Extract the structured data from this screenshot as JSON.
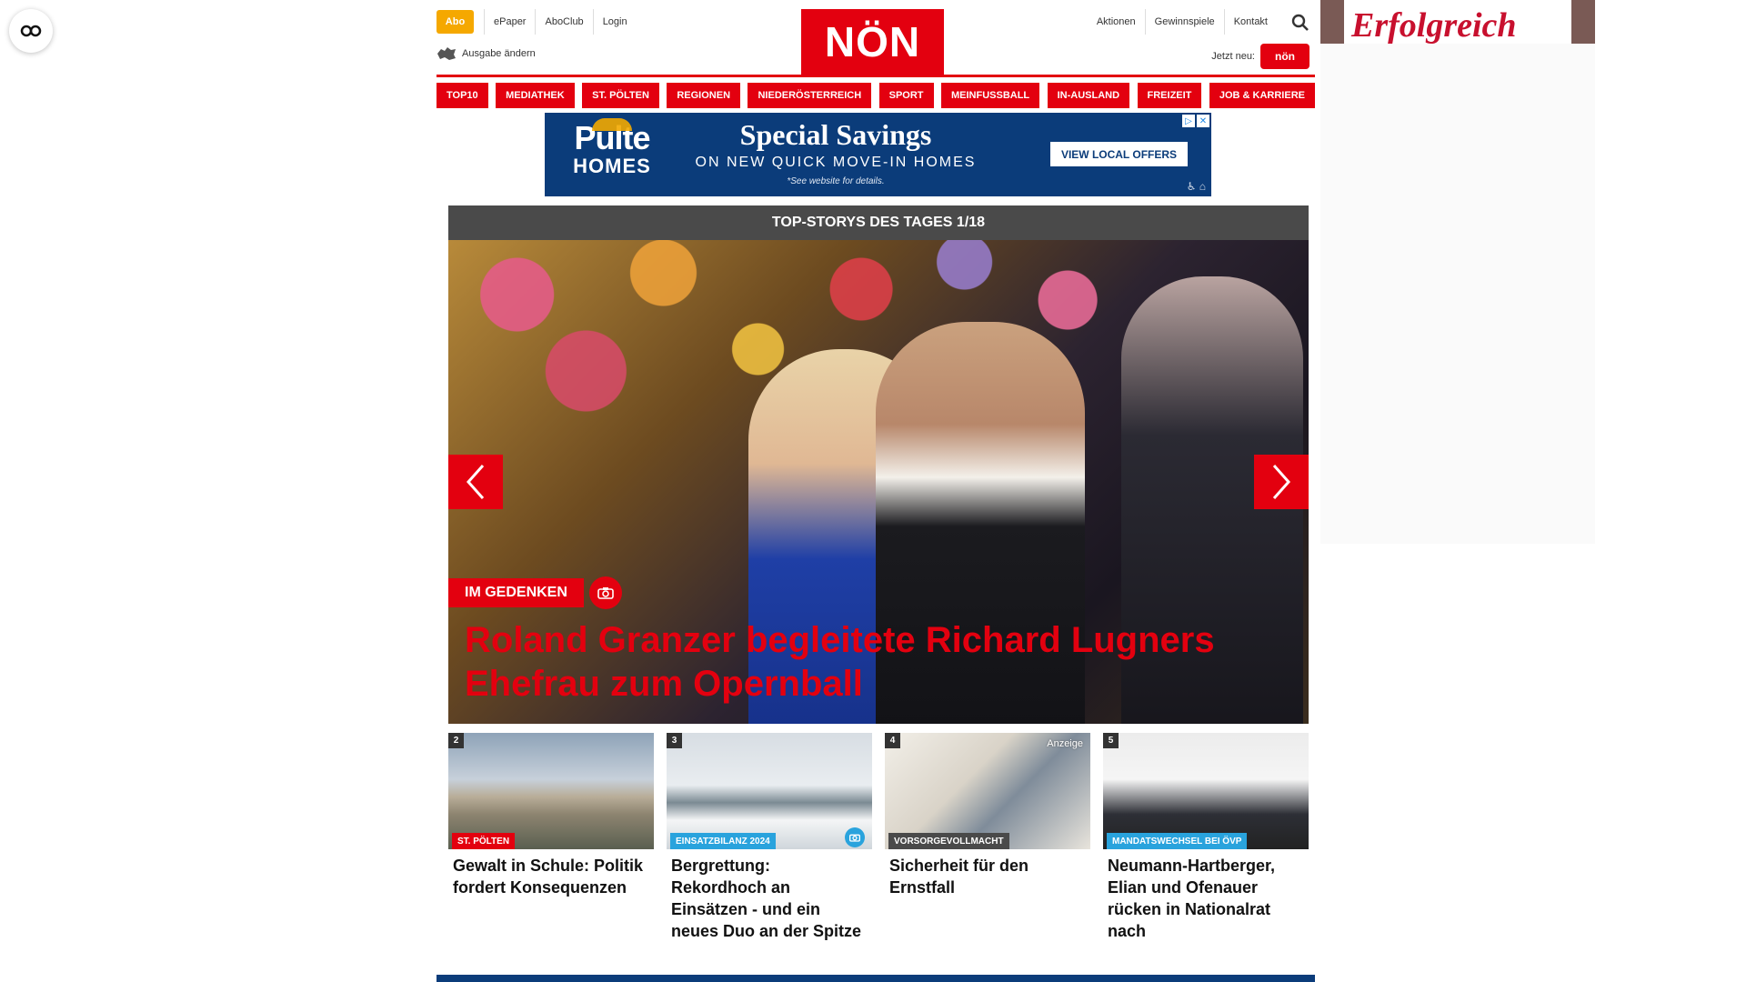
{
  "header": {
    "abo_label": "Abo",
    "left_links": [
      "ePaper",
      "AboClub",
      "Login"
    ],
    "ausgabe_label": "Ausgabe ändern",
    "logo_text": "NÖN",
    "right_links": [
      "Aktionen",
      "Gewinnspiele",
      "Kontakt"
    ],
    "jetzt_neu_label": "Jetzt neu:",
    "jetzt_neu_badge": "nön"
  },
  "side_ad": {
    "text": "Erfolgreich"
  },
  "nav": {
    "items": [
      "TOP10",
      "MEDIATHEK",
      "ST. PÖLTEN",
      "REGIONEN",
      "NIEDERÖSTERREICH",
      "SPORT",
      "MEINFUSSBALL",
      "IN-AUSLAND",
      "FREIZEIT",
      "JOB & KARRIERE"
    ]
  },
  "banner_ad": {
    "brand_line1": "Pulte",
    "brand_line2": "HOMES",
    "headline": "Special Savings",
    "subline": "ON NEW QUICK MOVE-IN HOMES",
    "disclaimer": "*See website for details.",
    "cta": "VIEW LOCAL OFFERS"
  },
  "top_stories": {
    "heading": "TOP-STORYS DES TAGES 1/18",
    "hero": {
      "tag": "IM GEDENKEN",
      "title": "Roland Granzer begleitete Richard Lugners Ehefrau zum Opernball"
    }
  },
  "teasers": [
    {
      "number": "2",
      "category": "ST. PÖLTEN",
      "title": "Gewalt in Schule: Politik fordert Konsequenzen"
    },
    {
      "number": "3",
      "category": "EINSATZBILANZ 2024",
      "title": "Bergrettung: Rekordhoch an Einsätzen - und ein neues Duo an der Spitze"
    },
    {
      "number": "4",
      "category": "VORSORGEVOLLMACHT",
      "badge": "Anzeige",
      "title": "Sicherheit für den Ernstfall"
    },
    {
      "number": "5",
      "category": "MANDATSWECHSEL BEI ÖVP",
      "title": "Neumann-Hartberger, Elian und Ofenauer rücken in Nationalrat nach"
    }
  ],
  "colors": {
    "brand_red": "#e3000f",
    "abo_orange": "#f5a800",
    "category_blue": "#29a3dd",
    "ad_navy": "#0b3c7a"
  }
}
